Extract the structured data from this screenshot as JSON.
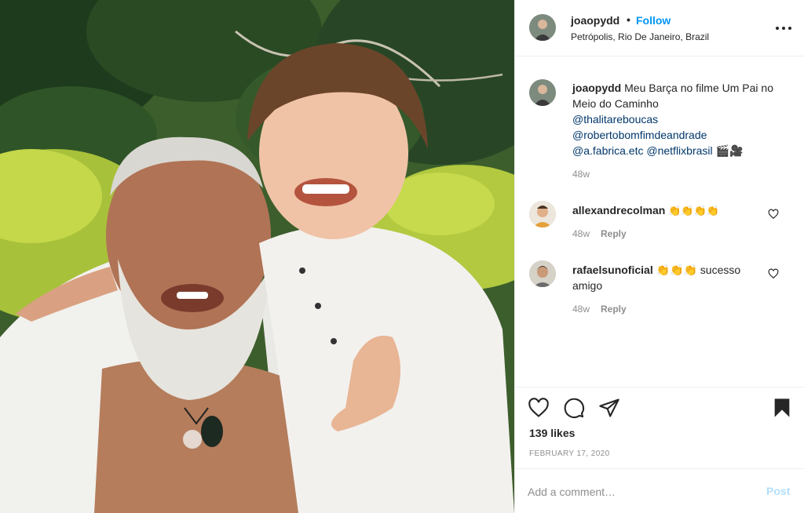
{
  "post": {
    "username": "joaopydd",
    "follow_label": "Follow",
    "separator": "•",
    "location": "Petrópolis, Rio De Janeiro, Brazil",
    "more_icon": "more-options-icon"
  },
  "caption": {
    "username": "joaopydd",
    "text": "Meu Barça no filme Um Pai no Meio do Caminho",
    "mentions": [
      "@thalitareboucas",
      "@robertobomfimdeandrade",
      "@a.fabrica.etc",
      "@netflixbrasil"
    ],
    "emoji": "🎬🎥",
    "time": "48w"
  },
  "comments": [
    {
      "username": "allexandrecolman",
      "text": "👏👏👏👏",
      "time": "48w",
      "reply_label": "Reply"
    },
    {
      "username": "rafaelsunoficial",
      "text": "👏👏👏 sucesso amigo",
      "time": "48w",
      "reply_label": "Reply"
    }
  ],
  "actions": {
    "icons": [
      "heart-icon",
      "comment-icon",
      "share-icon",
      "bookmark-icon"
    ],
    "likes": "139 likes",
    "date": "FEBRUARY 17, 2020"
  },
  "add_comment": {
    "placeholder": "Add a comment…",
    "post_label": "Post"
  },
  "colors": {
    "link_blue": "#0095f6",
    "mention_blue": "#00376b",
    "muted": "#8e8e8e",
    "post_disabled": "#b2dffc"
  }
}
